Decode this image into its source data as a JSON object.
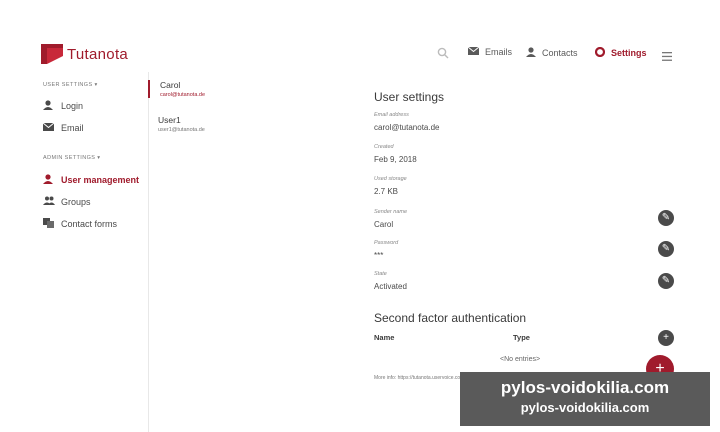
{
  "header": {
    "logo_text": "Tutanota",
    "nav": [
      {
        "label": "Emails",
        "icon": "mail-icon"
      },
      {
        "label": "Contacts",
        "icon": "contacts-icon"
      },
      {
        "label": "Settings",
        "icon": "settings-icon"
      }
    ],
    "accent": "#a01b2c"
  },
  "sidebar": {
    "user_settings_header": "USER SETTINGS",
    "user_items": [
      {
        "label": "Login",
        "icon": "user-icon"
      },
      {
        "label": "Email",
        "icon": "mail-icon"
      }
    ],
    "admin_settings_header": "ADMIN SETTINGS",
    "admin_items": [
      {
        "label": "User management",
        "icon": "user-icon"
      },
      {
        "label": "Groups",
        "icon": "groups-icon"
      },
      {
        "label": "Contact forms",
        "icon": "contact-forms-icon"
      }
    ]
  },
  "user_list": [
    {
      "name": "Carol",
      "email": "carol@tutanota.de"
    },
    {
      "name": "User1",
      "email": "user1@tutanota.de"
    }
  ],
  "detail": {
    "title": "User settings",
    "fields": [
      {
        "label": "Email address",
        "value": "carol@tutanota.de"
      },
      {
        "label": "Created",
        "value": "Feb 9, 2018"
      },
      {
        "label": "Used storage",
        "value": "2.7 KB"
      },
      {
        "label": "Sender name",
        "value": "Carol"
      },
      {
        "label": "Password",
        "value": "***"
      },
      {
        "label": "State",
        "value": "Activated"
      }
    ],
    "second_factor_title": "Second factor authentication",
    "table_headers": {
      "name": "Name",
      "type": "Type"
    },
    "no_entries": "<No entries>",
    "more_info": "More info: https://tutanota.uservoice.com/knowledgebase/articles/1201945"
  },
  "fab_label": "+",
  "watermark": {
    "line1": "pylos-voidokilia.com",
    "line2": "pylos-voidokilia.com"
  }
}
